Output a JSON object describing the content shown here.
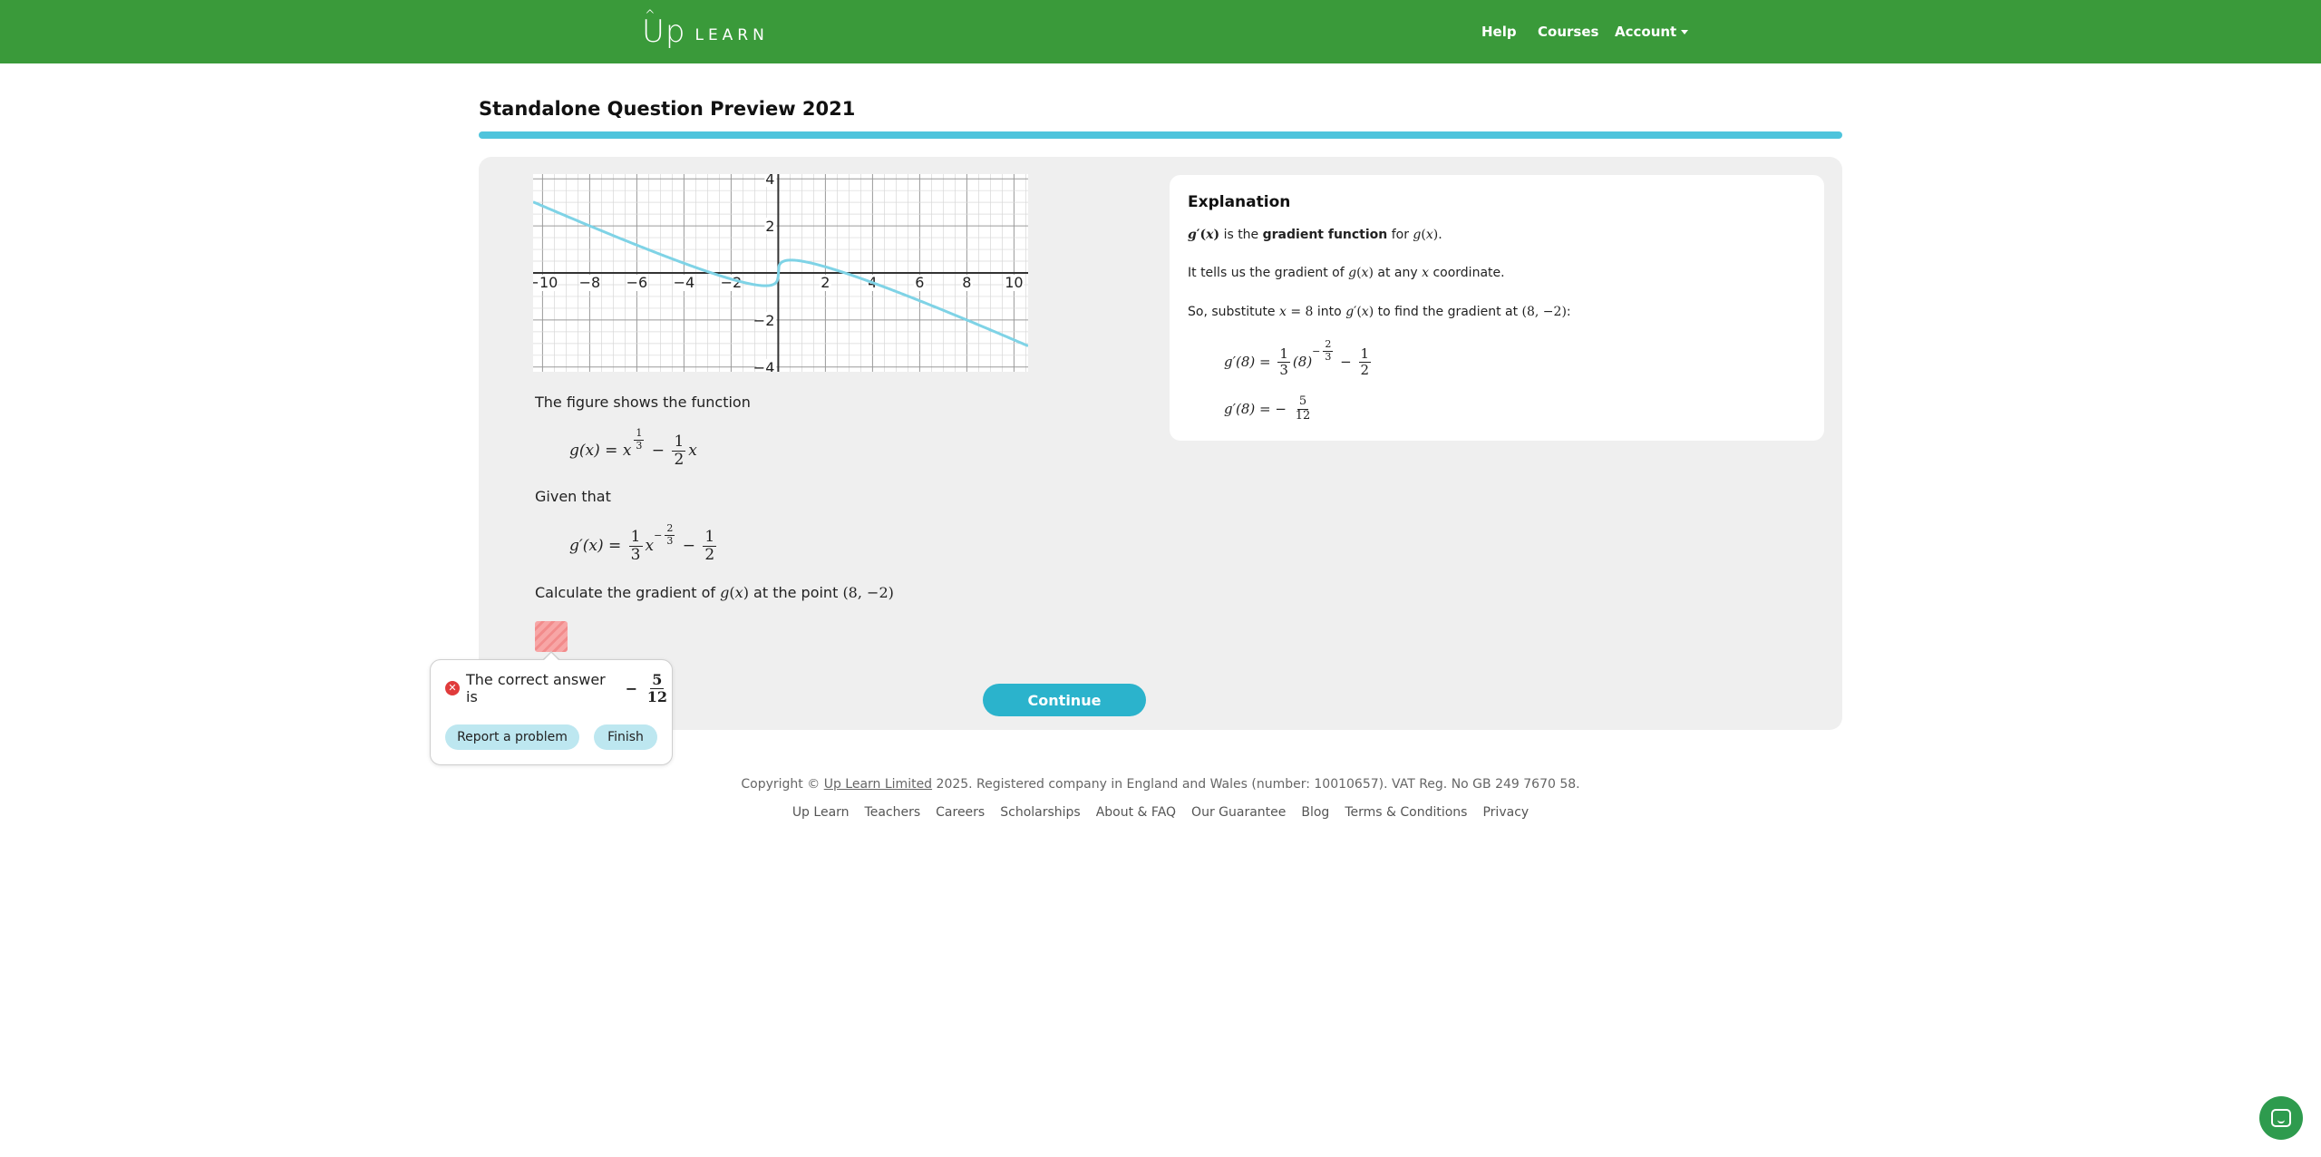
{
  "header": {
    "logo_up": "Up",
    "logo_learn": "LEARN",
    "nav": {
      "help": "Help",
      "courses": "Courses",
      "account": "Account"
    }
  },
  "page": {
    "title": "Standalone Question Preview 2021"
  },
  "question": {
    "intro": "The figure shows the function",
    "given": "Given that",
    "calc_prefix": "Calculate the gradient of",
    "calc_mid": "at the point",
    "calc_point": "(8, −2)"
  },
  "chart_data": {
    "type": "line",
    "title": "",
    "xlabel": "",
    "ylabel": "",
    "xlim": [
      -10.4,
      10.6
    ],
    "ylim": [
      -4.2,
      4.2
    ],
    "x_ticks": [
      -10,
      -8,
      -6,
      -4,
      -2,
      2,
      4,
      6,
      8,
      10
    ],
    "y_ticks": [
      -4,
      -2,
      2,
      4
    ],
    "x_tick_labels": [
      "−10",
      "−8",
      "−6",
      "−4",
      "−2",
      "2",
      "4",
      "6",
      "8",
      "10"
    ],
    "y_tick_labels": [
      "−4",
      "−2",
      "2",
      "4"
    ],
    "grid": true,
    "series": [
      {
        "function": "x^(1/3) - x/2",
        "color": "#7fd3e6"
      }
    ]
  },
  "feedback": {
    "message": "The correct answer is",
    "answer_sign": "−",
    "answer_num": "5",
    "answer_den": "12",
    "report_label": "Report a problem",
    "finish_label": "Finish"
  },
  "continue_label": "Continue",
  "explanation": {
    "title": "Explanation",
    "line1_mid": "is the",
    "line1_bold": "gradient function",
    "line1_end": "for",
    "line2_prefix": "It tells us the gradient of",
    "line2_mid": "at any",
    "line2_end": "coordinate.",
    "line3_prefix": "So, substitute",
    "line3_mid": "into",
    "line3_end": "to find the gradient at",
    "line3_point": "(8, −2)",
    "line3_colon": ":"
  },
  "footer": {
    "copyright_prefix": "Copyright ©",
    "company_link": "Up Learn Limited",
    "copyright_suffix": "2025. Registered company in England and Wales (number: 10010657). VAT Reg. No GB 249 7670 58.",
    "links": [
      "Up Learn",
      "Teachers",
      "Careers",
      "Scholarships",
      "About & FAQ",
      "Our Guarantee",
      "Blog",
      "Terms & Conditions",
      "Privacy"
    ]
  },
  "colors": {
    "brand_green": "#3a9a3a",
    "accent_cyan": "#2bb3cc",
    "curve": "#7fd3e6",
    "error_red": "#e03b3b"
  }
}
